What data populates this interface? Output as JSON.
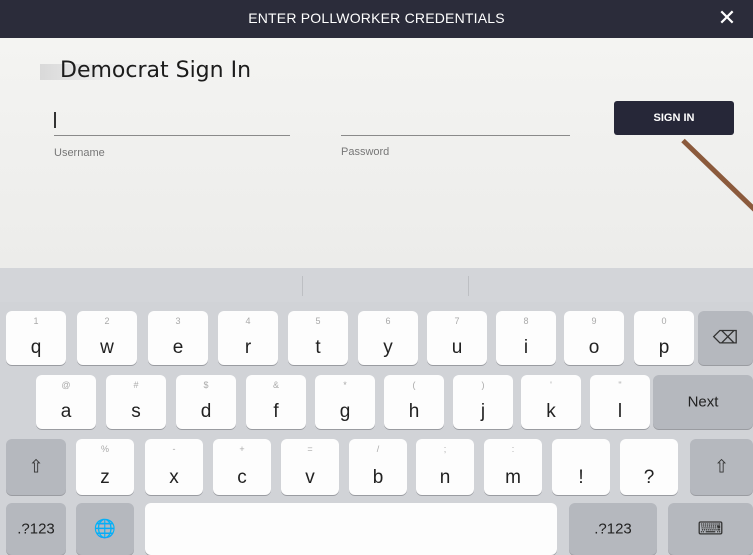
{
  "header": {
    "title": "ENTER POLLWORKER CREDENTIALS",
    "close_symbol": "✕"
  },
  "form": {
    "heading": "Democrat Sign In",
    "username_label": "Username",
    "password_label": "Password",
    "username_value": "",
    "password_value": "",
    "signin_label": "SIGN IN"
  },
  "keyboard": {
    "row1": [
      {
        "k": "q",
        "a": "1"
      },
      {
        "k": "w",
        "a": "2"
      },
      {
        "k": "e",
        "a": "3"
      },
      {
        "k": "r",
        "a": "4"
      },
      {
        "k": "t",
        "a": "5"
      },
      {
        "k": "y",
        "a": "6"
      },
      {
        "k": "u",
        "a": "7"
      },
      {
        "k": "i",
        "a": "8"
      },
      {
        "k": "o",
        "a": "9"
      },
      {
        "k": "p",
        "a": "0"
      }
    ],
    "row2": [
      {
        "k": "a",
        "a": "@"
      },
      {
        "k": "s",
        "a": "#"
      },
      {
        "k": "d",
        "a": "$"
      },
      {
        "k": "f",
        "a": "&"
      },
      {
        "k": "g",
        "a": "*"
      },
      {
        "k": "h",
        "a": "("
      },
      {
        "k": "j",
        "a": ")"
      },
      {
        "k": "k",
        "a": "'"
      },
      {
        "k": "l",
        "a": "\""
      }
    ],
    "row3": [
      {
        "k": "z",
        "a": "%"
      },
      {
        "k": "x",
        "a": "-"
      },
      {
        "k": "c",
        "a": "+"
      },
      {
        "k": "v",
        "a": "="
      },
      {
        "k": "b",
        "a": "/"
      },
      {
        "k": "n",
        "a": ";"
      },
      {
        "k": "m",
        "a": ":"
      },
      {
        "k": "!",
        "a": ""
      },
      {
        "k": "?",
        "a": ""
      }
    ],
    "row3_extra": {
      "excl_sub": ",",
      "quest_sub": "."
    },
    "next_label": "Next",
    "numbers_left": ".?123",
    "numbers_right": ".?123",
    "icons": {
      "backspace": "⌫",
      "shift": "⇧",
      "globe": "🌐",
      "hide_keyboard": "⌨"
    }
  }
}
